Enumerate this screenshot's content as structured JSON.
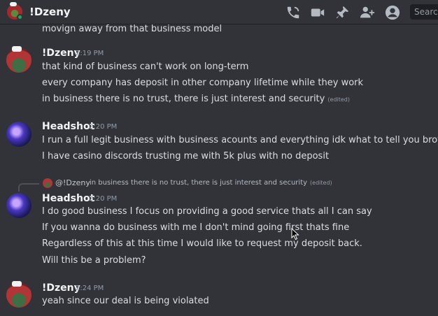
{
  "header": {
    "name": "!Dzeny",
    "icons": [
      "phone-call-icon",
      "video-icon",
      "pin-icon",
      "add-friend-icon",
      "profile-icon"
    ],
    "search_placeholder": "Search"
  },
  "clipped_text": "movign away from that business model",
  "messages": [
    {
      "author": "!Dzeny",
      "time": "2:19 PM",
      "lines": [
        "that kind of business can't work on long-term",
        "every company has deposit in other company lifetime while they work",
        "in business there is no trust, there is just interest and security"
      ],
      "edited_label": "(edited)"
    },
    {
      "author": "Headshot",
      "time": "2:20 PM",
      "lines": [
        "I run a full legit business with business acounts and everything idk what to tell you brother",
        "I have casino discords trusting me with 5k plus with no deposit"
      ]
    },
    {
      "reply": {
        "name": "@!Dzeny",
        "text": "in business there is no trust, there is just interest and security",
        "edited_label": "(edited)"
      },
      "author": "Headshot",
      "time": "2:20 PM",
      "lines": [
        "I do good business I focus on providing a good service thats all I can say",
        "If you wanna do business with me I don't mind going first thats fine",
        "Regardless of this at this time I would like to request my deposit back.",
        "Will this be a problem?"
      ]
    },
    {
      "author": "!Dzeny",
      "time": "2:24 PM",
      "lines": [
        "yeah since our deal is being violated"
      ]
    }
  ]
}
